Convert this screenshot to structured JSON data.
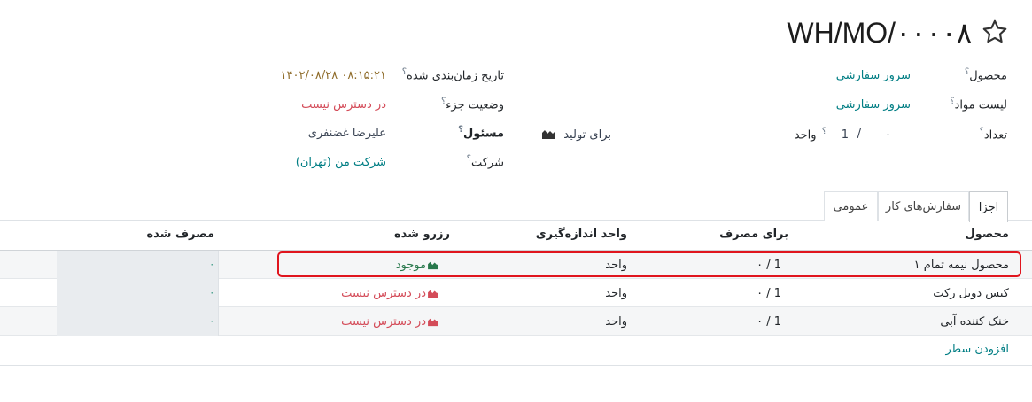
{
  "record": {
    "title": "WH/MO/۰۰۰۰۸"
  },
  "fields": {
    "product": {
      "label": "محصول",
      "value": "سرور سفارشی"
    },
    "bom": {
      "label": "لیست مواد",
      "value": "سرور سفارشی"
    },
    "quantity": {
      "label": "تعداد",
      "produced": "۰",
      "separator": "/",
      "total": "1",
      "unit": "واحد",
      "to_produce_label": "برای تولید"
    },
    "scheduled_date": {
      "label": "تاریخ زمان‌بندی شده",
      "value": "۱۴۰۲/۰۸/۲۸ ۰۸:۱۵:۲۱"
    },
    "component_status": {
      "label": "وضعیت جزء",
      "value": "در دسترس نیست"
    },
    "responsible": {
      "label": "مسئول",
      "value": "علیرضا غضنفری"
    },
    "company": {
      "label": "شرکت",
      "value": "شرکت من (تهران)"
    }
  },
  "tabs": [
    {
      "label": "اجزا",
      "active": true
    },
    {
      "label": "سفارش‌های کار",
      "active": false
    },
    {
      "label": "عمومی",
      "active": false
    }
  ],
  "table": {
    "headers": {
      "product": "محصول",
      "to_consume": "برای مصرف",
      "uom": "واحد اندازه‌گیری",
      "reserved": "رزرو شده",
      "consumed": "مصرف شده"
    },
    "rows": [
      {
        "product": "محصول نیمه تمام ۱",
        "to_consume": "۰ /  1",
        "uom": "واحد",
        "reserved": "موجود",
        "reserved_status": "available",
        "consumed": "۰"
      },
      {
        "product": "کیس دوبل رکت",
        "to_consume": "۰ /  1",
        "uom": "واحد",
        "reserved": "در دسترس نیست",
        "reserved_status": "unavailable",
        "consumed": "۰"
      },
      {
        "product": "خنک کننده آبی",
        "to_consume": "۰ /  1",
        "uom": "واحد",
        "reserved": "در دسترس نیست",
        "reserved_status": "unavailable",
        "consumed": "۰"
      }
    ],
    "add_line_label": "افزودن سطر"
  },
  "colors": {
    "available": "#28784c",
    "unavailable": "#d44c59",
    "highlight": "#e0151e",
    "link": "#017e84"
  }
}
